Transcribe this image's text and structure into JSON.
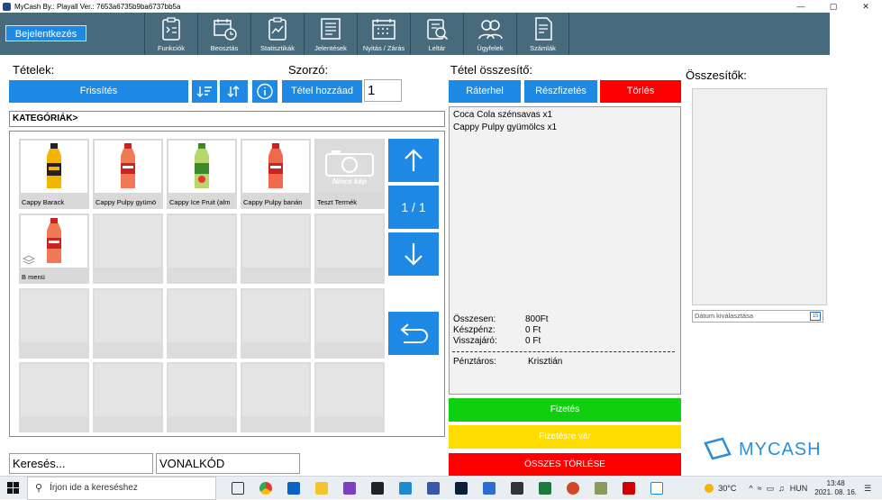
{
  "window": {
    "title": "MyCash By.: Playall   Ver.: 7653a6735b9ba6737bb5a",
    "controls": [
      "—",
      "▢",
      "✕"
    ]
  },
  "nav": {
    "login_label": "Bejelentkezés",
    "items": [
      {
        "label": "Funkciók",
        "icon": "functions-icon"
      },
      {
        "label": "Beosztás",
        "icon": "schedule-icon"
      },
      {
        "label": "Statisztikák",
        "icon": "statistics-icon"
      },
      {
        "label": "Jelentések",
        "icon": "reports-icon"
      },
      {
        "label": "Nyitás / Zárás",
        "icon": "open-close-icon"
      },
      {
        "label": "Leltár",
        "icon": "inventory-icon"
      },
      {
        "label": "Ügyfelek",
        "icon": "customers-icon"
      },
      {
        "label": "Számlák",
        "icon": "invoices-icon"
      }
    ]
  },
  "items_panel": {
    "title": "Tételek:",
    "refresh_label": "Frissítés",
    "multiplier_title": "Szorzó:",
    "add_item_label": "Tétel hozzáad",
    "quantity_value": "1",
    "category_label": "KATEGÓRIÁK>",
    "page_indicator": "1 / 1",
    "products": [
      {
        "name": "Cappy Barack",
        "color": "#f5b400"
      },
      {
        "name": "Cappy Pulpy gyümö",
        "color": "#f07a55"
      },
      {
        "name": "Cappy Ice Fruit (alm",
        "color": "#9cc83a"
      },
      {
        "name": "Cappy Pulpy banán",
        "color": "#ef6a4c"
      },
      {
        "name": "Teszt Termék",
        "no_image_label": "Nincs kép"
      },
      {
        "name": "B menü",
        "color": "#f07a55"
      }
    ]
  },
  "summary": {
    "title": "Tétel összesítő:",
    "buttons": {
      "park": "Ráterhel",
      "partial": "Részfizetés",
      "delete": "Törlés"
    },
    "lines": [
      "Coca Cola szénsavas x1",
      "Cappy Pulpy gyümölcs x1"
    ],
    "total_label": "Összesen:",
    "total_value": "800Ft",
    "cash_label": "Készpénz:",
    "cash_value": "0 Ft",
    "change_label": "Visszajáró:",
    "change_value": "0 Ft",
    "cashier_label": "Pénztáros:",
    "cashier_value": "Krisztián",
    "pay_label": "Fizetés",
    "wait_label": "Fizetésre vár",
    "clear_all_label": "ÖSSZES TÖRLÉSE"
  },
  "totals": {
    "title": "Összesítők:",
    "date_placeholder": "Dátum kiválasztása",
    "calendar_day": "15"
  },
  "search": {
    "search_text": "Keresés...",
    "barcode_text": "VONALKÓD"
  },
  "brand": {
    "logo_text": "MYCASH"
  },
  "taskbar": {
    "search_placeholder": "Írjon ide a kereséshez",
    "weather": "30°C",
    "language": "HUN",
    "time": "13:48",
    "date": "2021. 08. 16."
  },
  "colors": {
    "nav_bg": "#476a7c",
    "accent": "#1e88e5",
    "danger": "#ff0000",
    "success": "#0fd00f",
    "warning": "#ffdd00"
  }
}
